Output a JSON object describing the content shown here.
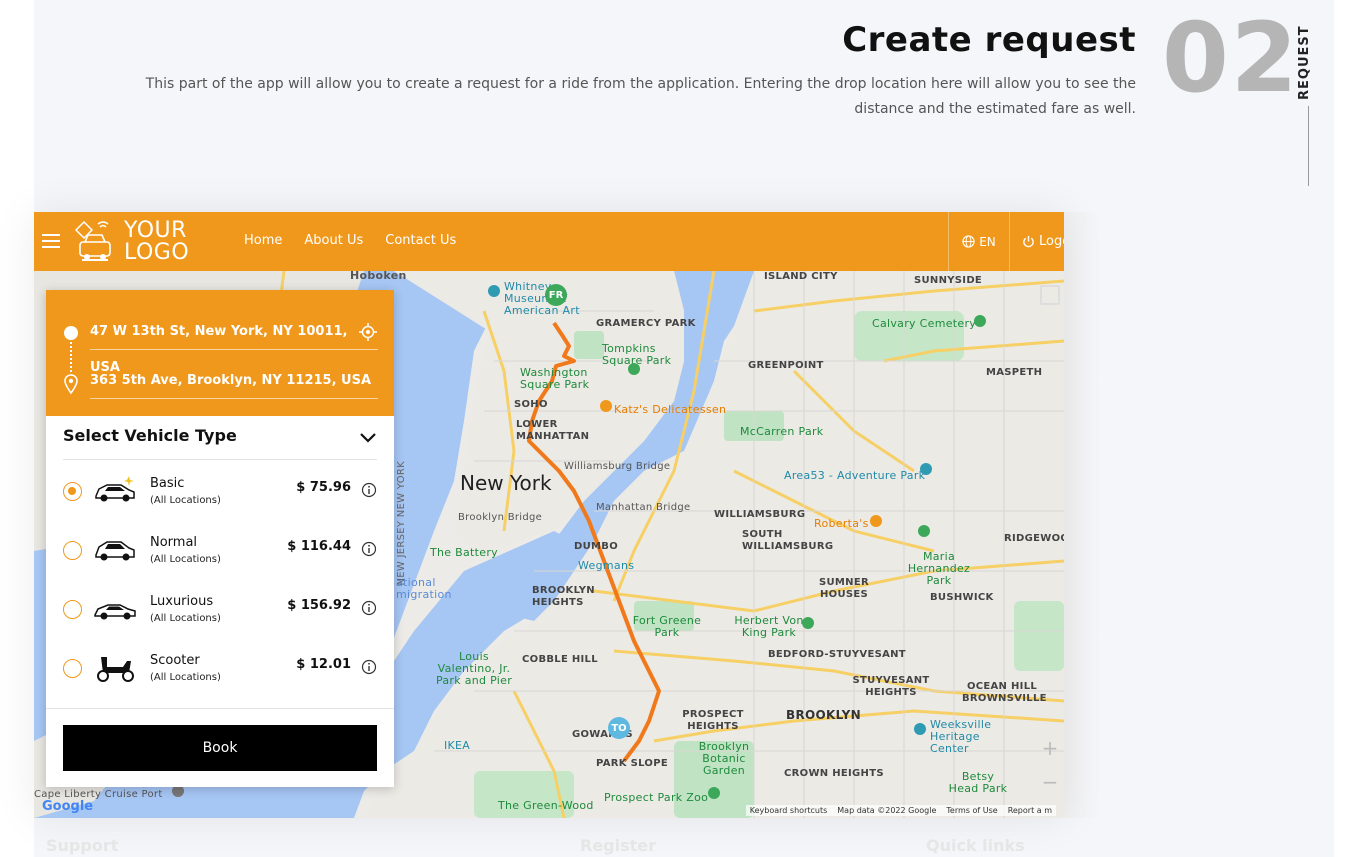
{
  "section": {
    "title": "Create request",
    "description": "This part of the app will allow you to create a request for a ride from the application. Entering the drop location here will allow you to see the distance and the estimated fare as well.",
    "number": "02",
    "vertical_label": "REQUEST"
  },
  "header": {
    "logo_line1": "YOUR",
    "logo_line2": "LOGO",
    "nav": [
      "Home",
      "About Us",
      "Contact Us"
    ],
    "language": "EN",
    "logout": "Logout"
  },
  "request": {
    "from": "47 W 13th St, New York, NY 10011, USA",
    "to": "363 5th Ave, Brooklyn, NY 11215, USA",
    "vehicle_title": "Select Vehicle Type",
    "vehicles": [
      {
        "name": "Basic",
        "sub": "(All Locations)",
        "price": "$ 75.96",
        "selected": true
      },
      {
        "name": "Normal",
        "sub": "(All Locations)",
        "price": "$ 116.44",
        "selected": false
      },
      {
        "name": "Luxurious",
        "sub": "(All Locations)",
        "price": "$ 156.92",
        "selected": false
      },
      {
        "name": "Scooter",
        "sub": "(All Locations)",
        "price": "$ 12.01",
        "selected": false
      }
    ],
    "book_label": "Book"
  },
  "map": {
    "city_label": "New York",
    "pin_from": "FR",
    "pin_to": "TO",
    "labels": {
      "hoboken": "Hoboken",
      "island_city": "ISLAND CITY",
      "sunnyside": "SUNNYSIDE",
      "whitney": "Whitney Museum of American Art",
      "gramercy": "GRAMERCY PARK",
      "tompkins": "Tompkins Square Park",
      "washington": "Washington Square Park",
      "calvary": "Calvary Cemetery",
      "greenpoint": "GREENPOINT",
      "maspeth": "MASPETH",
      "soho": "SOHO",
      "katz": "Katz's Delicatessen",
      "lower_manhattan": "LOWER MANHATTAN",
      "mccarren": "McCarren Park",
      "williamsburg_bridge": "Williamsburg Bridge",
      "area53": "Area53 - Adventure Park",
      "manhattan_bridge": "Manhattan Bridge",
      "brooklyn_bridge": "Brooklyn Bridge",
      "williamsburg": "WILLIAMSBURG",
      "south_williamsburg": "SOUTH WILLIAMSBURG",
      "robertas": "Roberta's",
      "ridgewood": "RIDGEWOOD",
      "the_battery": "The Battery",
      "dumbo": "DUMBO",
      "wegmans": "Wegmans",
      "maria_hernandez": "Maria Hernandez Park",
      "sumner": "SUMNER HOUSES",
      "bushwick": "BUSHWICK",
      "brooklyn_heights": "BROOKLYN HEIGHTS",
      "fort_greene": "Fort Greene Park",
      "herbert_von_king": "Herbert Von King Park",
      "cobble_hill": "COBBLE HILL",
      "bedford": "BEDFORD-STUYVESANT",
      "louis_valentino": "Louis Valentino, Jr. Park and Pier",
      "stuyvesant_heights": "STUYVESANT HEIGHTS",
      "ocean_hill": "OCEAN HILL BROWNSVILLE",
      "prospect_heights": "PROSPECT HEIGHTS",
      "brooklyn": "BROOKLYN",
      "weeksville": "Weeksville Heritage Center",
      "ikea": "IKEA",
      "gowanus": "GOWANUS",
      "park_slope": "PARK SLOPE",
      "botanic": "Brooklyn Botanic Garden",
      "crown_heights": "CROWN HEIGHTS",
      "betsy": "Betsy Head Park",
      "cape_liberty": "Cape Liberty Cruise Port",
      "green_wood": "The Green-Wood",
      "prospect_zoo": "Prospect Park Zoo",
      "immigration": "ational migration",
      "nj_ny": "NEW JERSEY NEW YORK"
    },
    "footer": [
      "Keyboard shortcuts",
      "Map data ©2022 Google",
      "Terms of Use",
      "Report a m"
    ],
    "google": "Google"
  },
  "footer_ghost": [
    "Support",
    "Register",
    "Quick links"
  ]
}
